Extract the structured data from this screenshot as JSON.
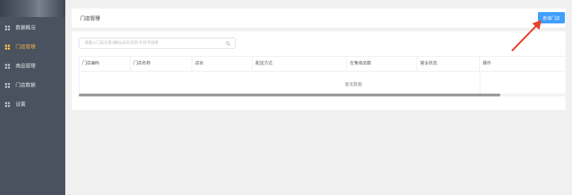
{
  "sidebar": {
    "items": [
      {
        "label": "数据概况",
        "icon": "grid-icon",
        "active": false
      },
      {
        "label": "门店管理",
        "icon": "grid-icon",
        "active": true
      },
      {
        "label": "商品管理",
        "icon": "grid-icon",
        "active": false
      },
      {
        "label": "门店数据",
        "icon": "grid-icon",
        "active": false
      },
      {
        "label": "设置",
        "icon": "grid-icon",
        "active": false
      }
    ],
    "active_color": "#f4b547",
    "bg_color": "#4a5260"
  },
  "header": {
    "title": "门店管理",
    "add_button_label": "新增门店",
    "button_color": "#409eff"
  },
  "search": {
    "placeholder": "请输入门店名称/编码/店长名称/手机号搜索",
    "value": ""
  },
  "table": {
    "columns": [
      "门店编码",
      "门店名称",
      "店长",
      "配送方式",
      "在售商品数",
      "营业状态",
      "操作"
    ],
    "empty_text": "暂无数据"
  },
  "annotation": {
    "arrow_color": "#e8412c"
  }
}
